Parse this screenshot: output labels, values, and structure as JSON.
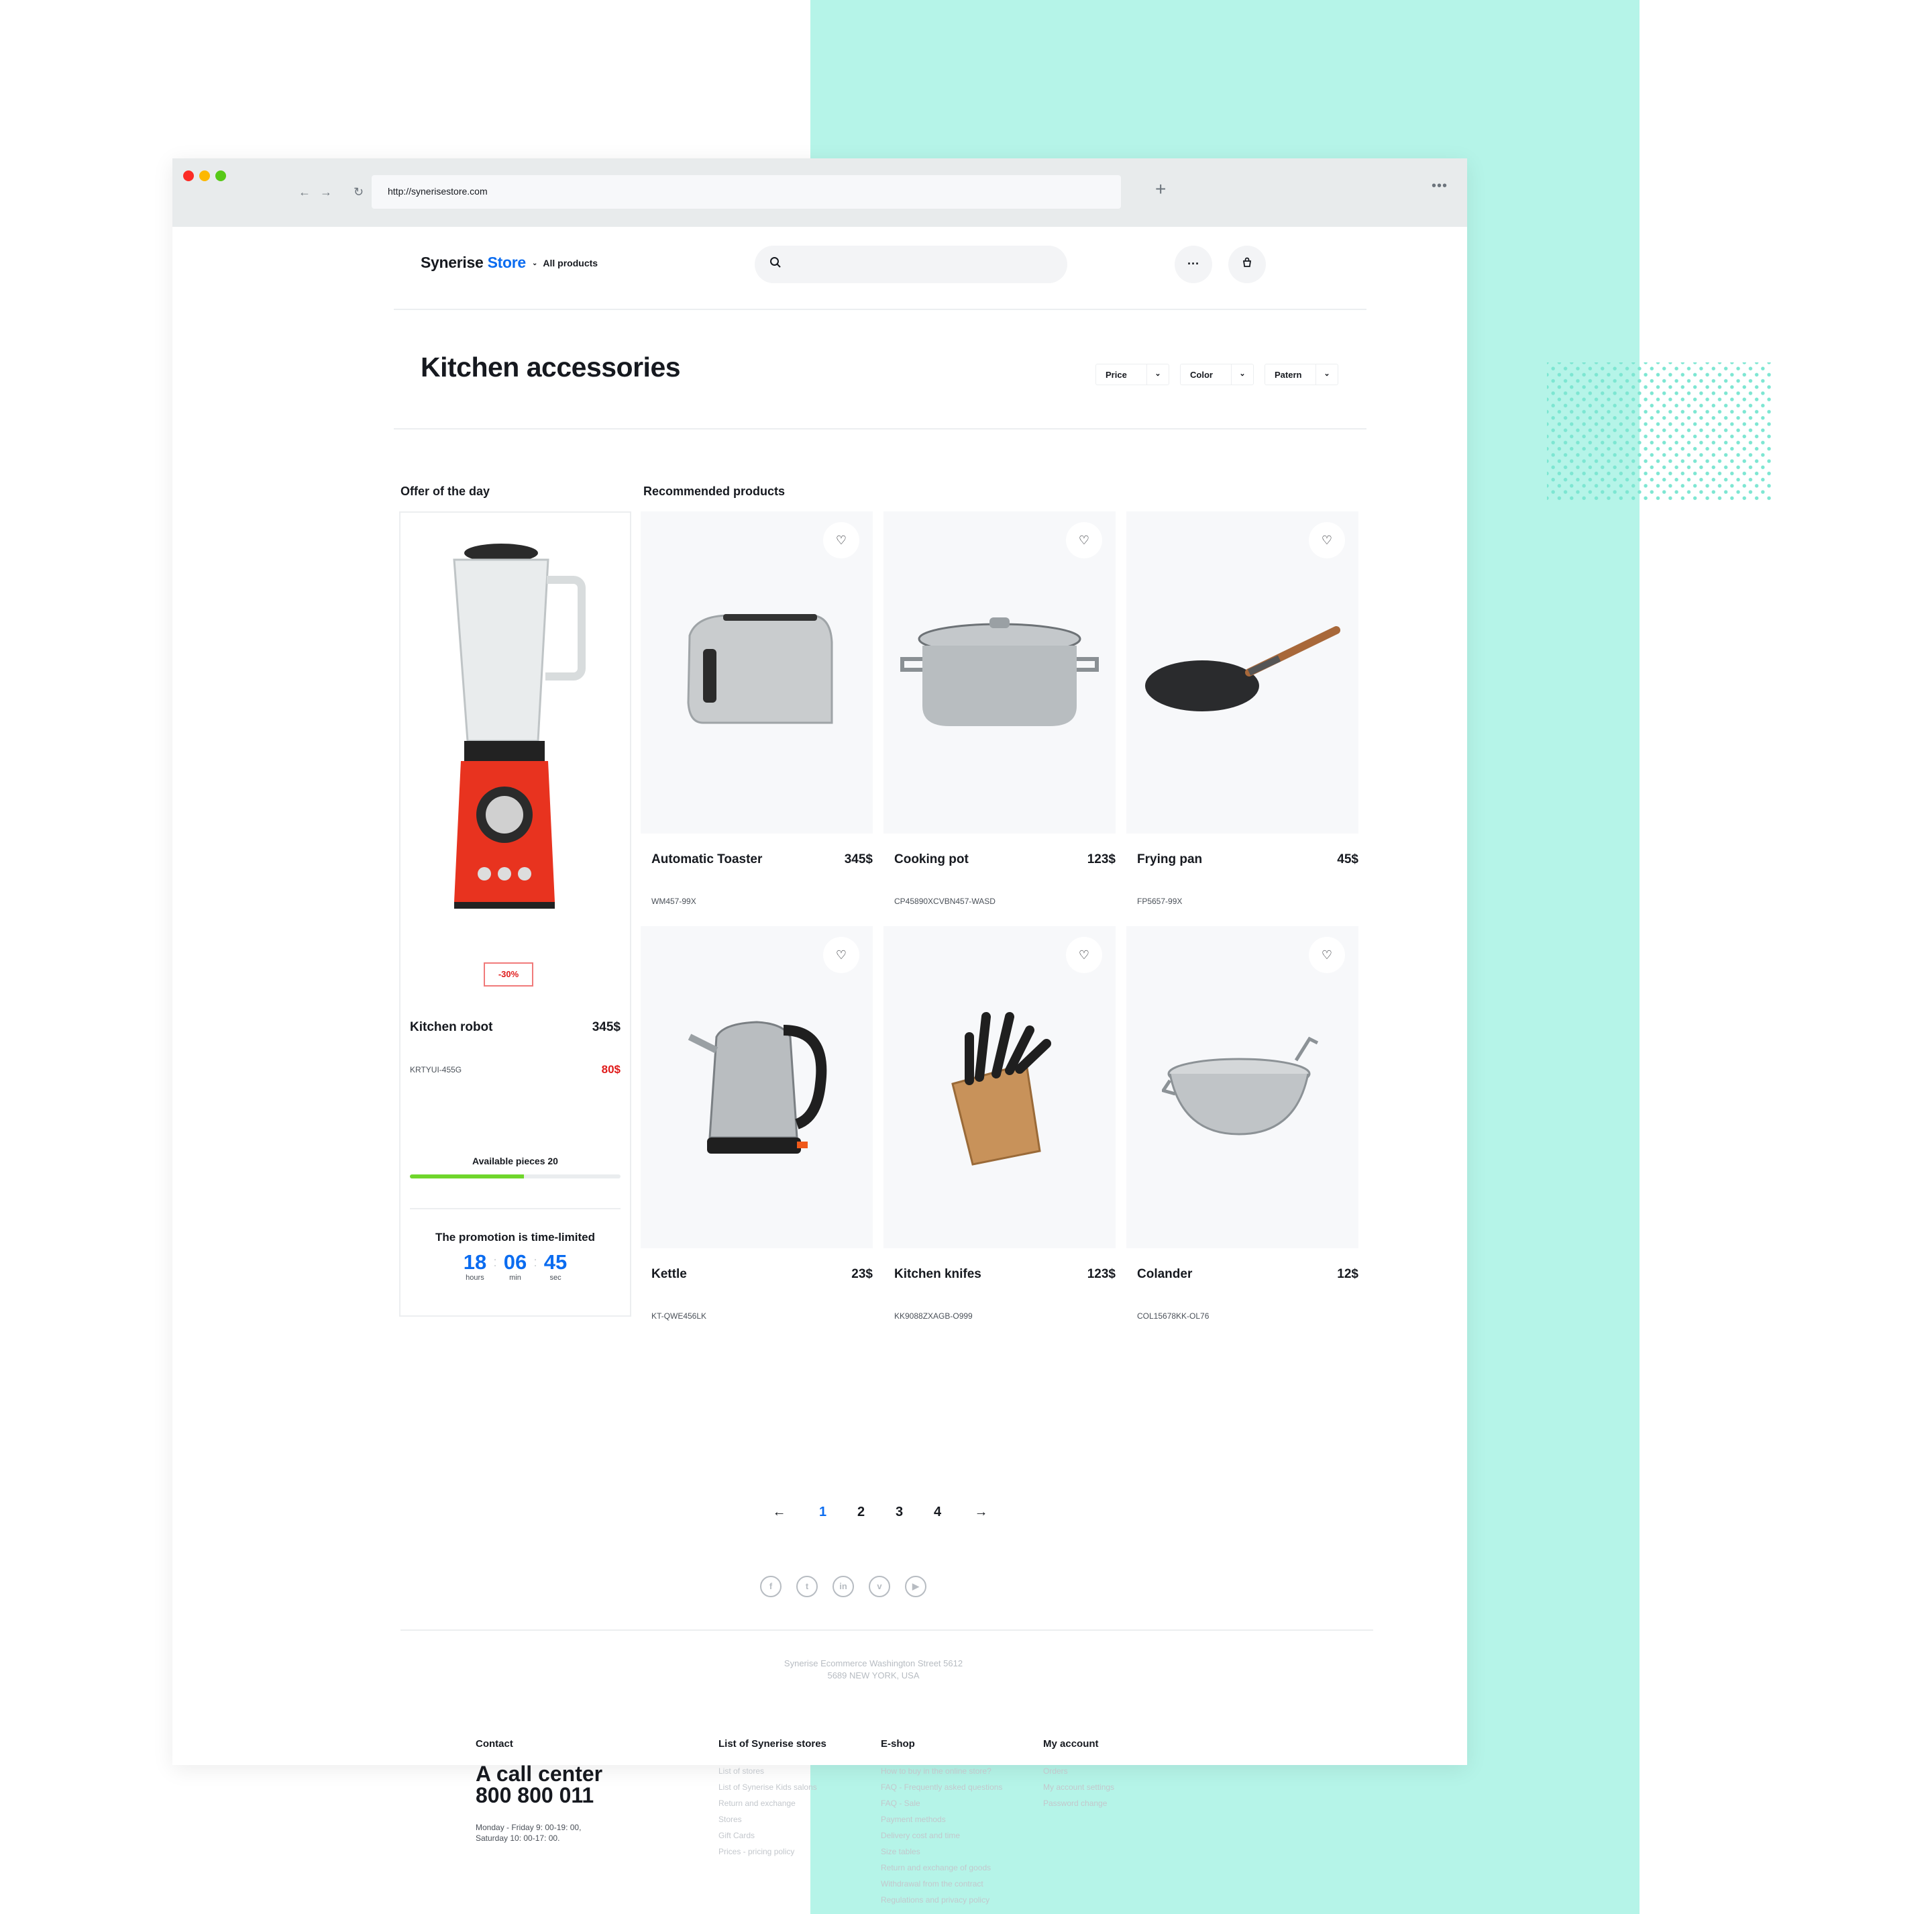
{
  "colors": {
    "accent": "#0b6cf0",
    "sale": "#e01b1b",
    "progress": "#6fd62b",
    "teal": "#b5f4e8"
  },
  "browser": {
    "url": "http://synerisestore.com",
    "back_icon": "arrow-left",
    "forward_icon": "arrow-right",
    "reload_icon": "reload",
    "newtab_icon": "plus",
    "menu_icon": "ellipsis"
  },
  "header": {
    "logo_main": "Synerise",
    "logo_accent": "Store",
    "nav_label": "All products",
    "search_placeholder": "",
    "more_icon": "ellipsis",
    "cart_icon": "basket"
  },
  "page": {
    "title": "Kitchen accessories",
    "filters": [
      {
        "label": "Price"
      },
      {
        "label": "Color"
      },
      {
        "label": "Patern"
      }
    ]
  },
  "offer": {
    "heading": "Offer of the day",
    "badge": "-30%",
    "name": "Kitchen robot",
    "price": "345$",
    "sku": "KRTYUI-455G",
    "sale_price": "80$",
    "available_label": "Available pieces 20",
    "available_progress_percent": 54,
    "promo_label": "The promotion is time-limited",
    "timer": [
      {
        "value": "18",
        "unit": "hours"
      },
      {
        "value": "06",
        "unit": "min"
      },
      {
        "value": "45",
        "unit": "sec"
      }
    ]
  },
  "recommended": {
    "heading": "Recommended products",
    "products": [
      {
        "name": "Automatic Toaster",
        "price": "345$",
        "sku": "WM457-99X",
        "image": "toaster"
      },
      {
        "name": "Cooking pot",
        "price": "123$",
        "sku": "CP45890XCVBN457-WASD",
        "image": "pot"
      },
      {
        "name": "Frying pan",
        "price": "45$",
        "sku": "FP5657-99X",
        "image": "pan"
      },
      {
        "name": "Kettle",
        "price": "23$",
        "sku": "KT-QWE456LK",
        "image": "kettle"
      },
      {
        "name": "Kitchen knifes",
        "price": "123$",
        "sku": "KK9088ZXAGB-O999",
        "image": "knives"
      },
      {
        "name": "Colander",
        "price": "12$",
        "sku": "COL15678KK-OL76",
        "image": "colander"
      }
    ]
  },
  "pagination": {
    "prev": "←",
    "pages": [
      "1",
      "2",
      "3",
      "4"
    ],
    "current": "1",
    "next": "→"
  },
  "social": [
    {
      "name": "facebook",
      "glyph": "f"
    },
    {
      "name": "twitter",
      "glyph": "t"
    },
    {
      "name": "linkedin",
      "glyph": "in"
    },
    {
      "name": "vimeo",
      "glyph": "v"
    },
    {
      "name": "youtube",
      "glyph": "▶"
    }
  ],
  "footer": {
    "address_line1": "Synerise Ecommerce Washington Street 5612",
    "address_line2": "5689 NEW YORK, USA",
    "contact": {
      "heading": "Contact",
      "call_center": "A call center",
      "phone": "800 800 011",
      "hours_line1": "Monday - Friday 9: 00-19: 00,",
      "hours_line2": "Saturday 10: 00-17: 00."
    },
    "columns": [
      {
        "heading": "List of Synerise stores",
        "links": [
          "List of stores",
          "List of Synerise Kids salons",
          "Return and exchange",
          "Stores",
          "Gift Cards",
          "Prices - pricing policy"
        ]
      },
      {
        "heading": "E-shop",
        "links": [
          "How to buy in the online store?",
          "FAQ - Frequently asked questions",
          "FAQ - Sale",
          "Payment methods",
          "Delivery cost and time",
          "Size tables",
          "Return and exchange of goods",
          "Withdrawal from the contract",
          "Regulations and privacy policy"
        ]
      },
      {
        "heading": "My account",
        "links": [
          "Orders",
          "My account settings",
          "Password change"
        ]
      }
    ]
  }
}
